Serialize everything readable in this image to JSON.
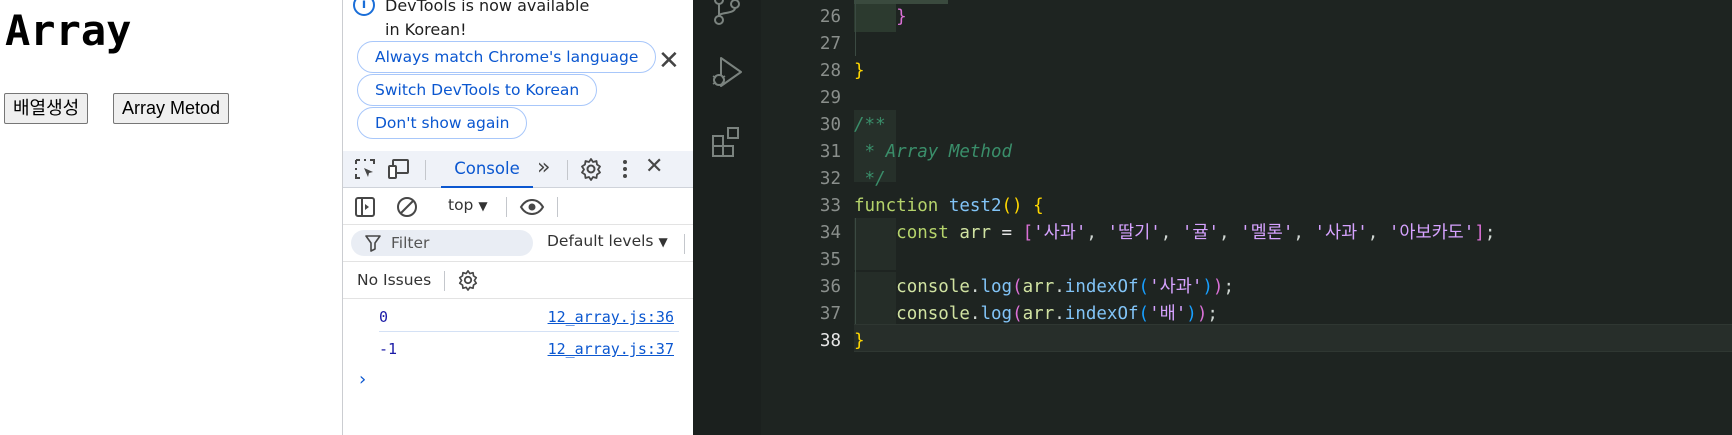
{
  "page": {
    "heading": "Array",
    "buttons": [
      "배열생성",
      "Array Metod"
    ]
  },
  "devtools": {
    "info_text": "DevTools is now available in Korean!",
    "info_buttons": [
      "Always match Chrome's language",
      "Switch DevTools to Korean",
      "Don't show again"
    ],
    "tabs": {
      "console": "Console"
    },
    "context": "top",
    "filter_placeholder": "Filter",
    "levels": "Default levels",
    "issues": "No Issues",
    "logs": [
      {
        "value": "0",
        "source": "12_array.js:36"
      },
      {
        "value": "-1",
        "source": "12_array.js:37"
      }
    ],
    "prompt": "›"
  },
  "editor": {
    "lines": [
      {
        "n": "26",
        "tokens": [
          [
            "b2",
            "}"
          ]
        ],
        "indent": 1
      },
      {
        "n": "27",
        "tokens": []
      },
      {
        "n": "28",
        "tokens": [
          [
            "b1",
            "}"
          ]
        ]
      },
      {
        "n": "29",
        "tokens": []
      },
      {
        "n": "30",
        "tokens": [
          [
            "cm",
            "/**"
          ]
        ]
      },
      {
        "n": "31",
        "tokens": [
          [
            "cm",
            " * Array Method"
          ]
        ]
      },
      {
        "n": "32",
        "tokens": [
          [
            "cm",
            " */"
          ]
        ]
      },
      {
        "n": "33",
        "tokens": [
          [
            "k",
            "function "
          ],
          [
            "f",
            "test2"
          ],
          [
            "b1",
            "()"
          ],
          [
            "p",
            " "
          ],
          [
            "b1",
            "{"
          ]
        ]
      },
      {
        "n": "34",
        "tokens": [
          [
            "p",
            "    "
          ],
          [
            "k",
            "const "
          ],
          [
            "v",
            "arr"
          ],
          [
            "op",
            " = "
          ],
          [
            "b2",
            "["
          ],
          [
            "str",
            "'사과'"
          ],
          [
            "p",
            ", "
          ],
          [
            "str",
            "'딸기'"
          ],
          [
            "p",
            ", "
          ],
          [
            "str",
            "'귤'"
          ],
          [
            "p",
            ", "
          ],
          [
            "str",
            "'멜론'"
          ],
          [
            "p",
            ", "
          ],
          [
            "str",
            "'사과'"
          ],
          [
            "p",
            ", "
          ],
          [
            "str",
            "'아보카도'"
          ],
          [
            "b2",
            "]"
          ],
          [
            "p",
            ";"
          ]
        ]
      },
      {
        "n": "35",
        "tokens": []
      },
      {
        "n": "36",
        "tokens": [
          [
            "p",
            "    "
          ],
          [
            "v",
            "console"
          ],
          [
            "p",
            "."
          ],
          [
            "f",
            "log"
          ],
          [
            "b2",
            "("
          ],
          [
            "v",
            "arr"
          ],
          [
            "p",
            "."
          ],
          [
            "f",
            "indexOf"
          ],
          [
            "b3",
            "("
          ],
          [
            "str",
            "'사과'"
          ],
          [
            "b3",
            ")"
          ],
          [
            "b2",
            ")"
          ],
          [
            "p",
            ";"
          ]
        ]
      },
      {
        "n": "37",
        "tokens": [
          [
            "p",
            "    "
          ],
          [
            "v",
            "console"
          ],
          [
            "p",
            "."
          ],
          [
            "f",
            "log"
          ],
          [
            "b2",
            "("
          ],
          [
            "v",
            "arr"
          ],
          [
            "p",
            "."
          ],
          [
            "f",
            "indexOf"
          ],
          [
            "b3",
            "("
          ],
          [
            "str",
            "'배'"
          ],
          [
            "b3",
            ")"
          ],
          [
            "b2",
            ")"
          ],
          [
            "p",
            ";"
          ]
        ]
      },
      {
        "n": "38",
        "tokens": [
          [
            "b1",
            "}"
          ]
        ],
        "active": true
      }
    ]
  },
  "colors": {
    "editor_bg": "#1e2421",
    "link": "#0b57d0",
    "string": "#d6a2ff",
    "keyword": "#b5d36b",
    "function": "#82c4f7",
    "comment": "#3a8e6a"
  },
  "icons": [
    "info-icon",
    "inspect-icon",
    "device-toolbar-icon",
    "more-tabs-icon",
    "settings-icon",
    "kebab-menu-icon",
    "close-icon",
    "sidebar-icon",
    "clear-console-icon",
    "eye-icon",
    "filter-icon",
    "source-control-icon",
    "run-debug-icon",
    "extensions-icon"
  ]
}
